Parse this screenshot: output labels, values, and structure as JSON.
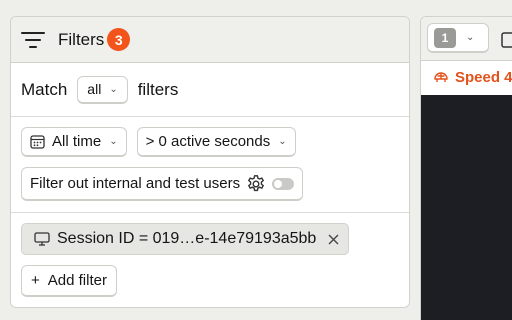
{
  "filters": {
    "title": "Filters",
    "count": "3",
    "match_label": "Match",
    "match_value": "all",
    "match_suffix": "filters",
    "time_range": "All time",
    "active_seconds": "> 0 active seconds",
    "internal_toggle_label": "Filter out internal and test users",
    "property_filter": "Session ID = 019…e-14e79193a5bb",
    "add_filter_label": "Add filter"
  },
  "player": {
    "page_number": "1",
    "speed_label": "Speed 4"
  },
  "colors": {
    "accent": "#f2541b",
    "badge_text": "#ffffff",
    "speed_text": "#e2531d"
  }
}
